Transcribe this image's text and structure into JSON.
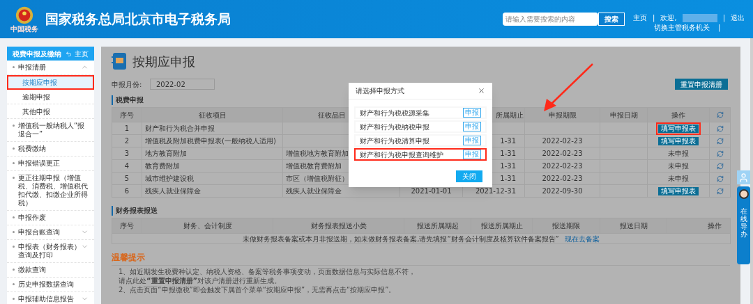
{
  "header": {
    "site_title": "国家税务总局北京市电子税务局",
    "logo_caption": "中国税务",
    "search": {
      "placeholder": "请输入需要搜索的内容",
      "button": "搜索"
    },
    "home_link": "主页",
    "separator": "|",
    "welcome": "欢迎,",
    "logout": "退出",
    "switch_office": "切换主管税务机关"
  },
  "sidebar": {
    "title": "税费申报及缴纳",
    "home": "主页",
    "items": [
      {
        "kind": "group",
        "label": "申报清册",
        "expanded": true,
        "children": [
          {
            "label": "按期应申报",
            "selected": true,
            "annotated": true
          },
          {
            "label": "逾期申报",
            "selected": false,
            "annotated": false
          },
          {
            "label": "其他申报",
            "selected": false,
            "annotated": false
          }
        ]
      },
      {
        "kind": "link",
        "label": "增值税一般纳税人“报退合一”"
      },
      {
        "kind": "link",
        "label": "税费缴纳"
      },
      {
        "kind": "link",
        "label": "申报错误更正"
      },
      {
        "kind": "link",
        "label": "更正往期申报（增值税、消费税、增值税代扣代缴、扣缴企业所得税）"
      },
      {
        "kind": "link",
        "label": "申报作废"
      },
      {
        "kind": "group",
        "label": "申报台账查询",
        "expanded": false
      },
      {
        "kind": "group",
        "label": "申报表（财务报表）查询及打印",
        "expanded": false
      },
      {
        "kind": "link",
        "label": "缴款查询"
      },
      {
        "kind": "link",
        "label": "历史申报数据查询"
      },
      {
        "kind": "group",
        "label": "申报辅助信息报告",
        "expanded": false
      }
    ]
  },
  "page": {
    "title": "按期应申报",
    "month_label": "申报月份:",
    "month_value": "2022-02",
    "reset_button": "重置申报清册"
  },
  "tax_section": {
    "title": "税费申报",
    "columns": [
      "序号",
      "征收项目",
      "征收品目",
      "",
      "所属期止",
      "申报期限",
      "申报日期",
      "操作"
    ],
    "rows": [
      {
        "cells": [
          "1",
          "财产和行为税合并申报",
          "",
          "",
          "",
          "",
          ""
        ],
        "action": {
          "kind": "button",
          "label": "填写申报表",
          "annotated": true
        }
      },
      {
        "cells": [
          "2",
          "增值税及附加税费申报表(一般纳税人适用)",
          "",
          "",
          "1-31",
          "2022-02-23",
          ""
        ],
        "action": {
          "kind": "button",
          "label": "填写申报表",
          "annotated": false
        }
      },
      {
        "cells": [
          "3",
          "地方教育附加",
          "增值税地方教育附加",
          "",
          "1-31",
          "2022-02-23",
          ""
        ],
        "action": {
          "kind": "status",
          "label": "未申报"
        }
      },
      {
        "cells": [
          "4",
          "教育费附加",
          "增值税教育费附加",
          "",
          "1-31",
          "2022-02-23",
          ""
        ],
        "action": {
          "kind": "status",
          "label": "未申报"
        }
      },
      {
        "cells": [
          "5",
          "城市维护建设税",
          "市区（增值税附征）",
          "",
          "1-31",
          "2022-02-23",
          ""
        ],
        "action": {
          "kind": "status",
          "label": "未申报"
        }
      },
      {
        "cells": [
          "6",
          "残疾人就业保障金",
          "残疾人就业保障金",
          "2021-01-01",
          "2021-12-31",
          "2022-09-30",
          ""
        ],
        "action": {
          "kind": "button",
          "label": "填写申报表",
          "annotated": false
        }
      }
    ]
  },
  "report_section": {
    "title": "财务报表报送",
    "columns": [
      "序号",
      "财务、会计制度",
      "财务报表报送小类",
      "报送所属期起",
      "报送所属期止",
      "报送期限",
      "报送日期",
      "操作"
    ],
    "empty_message": "未做财务报表备案或本月非报送期，如未做财务报表备案,请先填报“财务会计制度及核算软件备案报告”",
    "empty_link": "现在去备案"
  },
  "tips": {
    "title": "温馨提示",
    "lines": [
      "1、如近期发生税费种认定、纳税人资格、备案等税务事项变动，页面数据信息与实际信息不符，",
      "请点此处**“重置申报清册”**对该户清册进行重新生成。",
      "2、点击页面“申报缴税”即会触发下属首个菜单“按期应申报”，无需再点击“按期应申报”。"
    ]
  },
  "dialog": {
    "title": "请选择申报方式",
    "options": [
      {
        "label": "财产和行为税税源采集",
        "button": "申报",
        "annotated": false
      },
      {
        "label": "财产和行为税纳税申报",
        "button": "申报",
        "annotated": false
      },
      {
        "label": "财产和行为税清算申报",
        "button": "申报",
        "annotated": false
      },
      {
        "label": "财产和行为税申报查询维护",
        "button": "申报",
        "annotated": true
      }
    ],
    "close_button": "关闭"
  },
  "float_widget": {
    "label": "在线导办"
  }
}
